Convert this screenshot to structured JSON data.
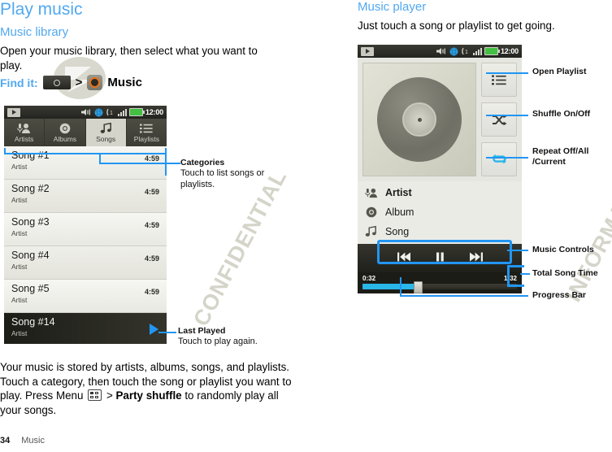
{
  "left": {
    "title": "Play music",
    "subtitle": "Music library",
    "intro": "Open your music library, then select what you want to play.",
    "find_it_label": "Find it:",
    "find_it_separator": ">",
    "find_it_target": "Music",
    "icons": {
      "app_tray": "app-tray-icon",
      "music_app": "music-app-icon"
    },
    "body_before_menu": "Your music is stored by artists, albums, songs, and playlists. Touch a category, then touch the song or playlist you want to play. Press Menu",
    "body_menu_sep": ">",
    "body_bold1": "Party shuffle",
    "body_after": " to randomly play all your songs."
  },
  "phone_library": {
    "statusbar": {
      "play_icon": "media-play-icon",
      "volume_icon": "volume-icon",
      "globe_icon": "globe-icon",
      "call_icon": "call-icon",
      "signal_icon": "signal-bars-icon",
      "battery_icon": "battery-icon",
      "clock": "12:00"
    },
    "tabs": [
      {
        "label": "Artists",
        "icon": "artist-icon",
        "selected": false
      },
      {
        "label": "Albums",
        "icon": "album-icon",
        "selected": false
      },
      {
        "label": "Songs",
        "icon": "song-note-icon",
        "selected": true
      },
      {
        "label": "Playlists",
        "icon": "playlist-icon",
        "selected": false
      }
    ],
    "songs": [
      {
        "name": "Song #1",
        "artist": "Artist",
        "duration": "4:59",
        "last_played": false
      },
      {
        "name": "Song #2",
        "artist": "Artist",
        "duration": "4:59",
        "last_played": false
      },
      {
        "name": "Song #3",
        "artist": "Artist",
        "duration": "4:59",
        "last_played": false
      },
      {
        "name": "Song #4",
        "artist": "Artist",
        "duration": "4:59",
        "last_played": false
      },
      {
        "name": "Song #5",
        "artist": "Artist",
        "duration": "4:59",
        "last_played": false
      },
      {
        "name": "Song #14",
        "artist": "Artist",
        "duration": "",
        "last_played": true
      }
    ]
  },
  "left_callouts": [
    {
      "title": "Categories",
      "desc": "Touch to list songs or playlists."
    },
    {
      "title": "Last Played",
      "desc": "Touch to play again."
    }
  ],
  "right": {
    "subtitle": "Music player",
    "intro": "Just touch a song or playlist to get going."
  },
  "phone_player": {
    "statusbar": {
      "play_icon": "media-play-icon",
      "clock": "12:00"
    },
    "album_art": "vinyl-record-art",
    "side_buttons": [
      {
        "icon": "playlist-icon",
        "name": "open-playlist-button"
      },
      {
        "icon": "shuffle-icon",
        "name": "shuffle-button"
      },
      {
        "icon": "repeat-icon",
        "name": "repeat-button"
      }
    ],
    "meta": [
      {
        "label": "Artist",
        "icon": "artist-icon",
        "bold": true
      },
      {
        "label": "Album",
        "icon": "album-icon",
        "bold": false
      },
      {
        "label": "Song",
        "icon": "song-note-icon",
        "bold": false
      }
    ],
    "controls": [
      {
        "icon": "previous-icon",
        "name": "previous-button"
      },
      {
        "icon": "pause-icon",
        "name": "pause-button"
      },
      {
        "icon": "next-icon",
        "name": "next-button"
      }
    ],
    "elapsed_time": "0:32",
    "total_time": "1:32",
    "progress_percent": 35
  },
  "right_callouts": [
    {
      "title": "Open Playlist"
    },
    {
      "title": "Shuffle On/Off"
    },
    {
      "title": "Repeat Off/All",
      "title2": "/Current"
    },
    {
      "title": "Music Controls"
    },
    {
      "title": "Total Song Time"
    },
    {
      "title": "Progress Bar"
    }
  ],
  "footer": {
    "page": "34",
    "section": "Music"
  },
  "watermark": {
    "line1": "CONFIDENTIAL",
    "line2": "INFORMATION"
  },
  "colors": {
    "accent": "#51a8f0",
    "callout_line": "#2196f3",
    "progress": "#29b6e8",
    "music_icon": "#e8711a"
  }
}
